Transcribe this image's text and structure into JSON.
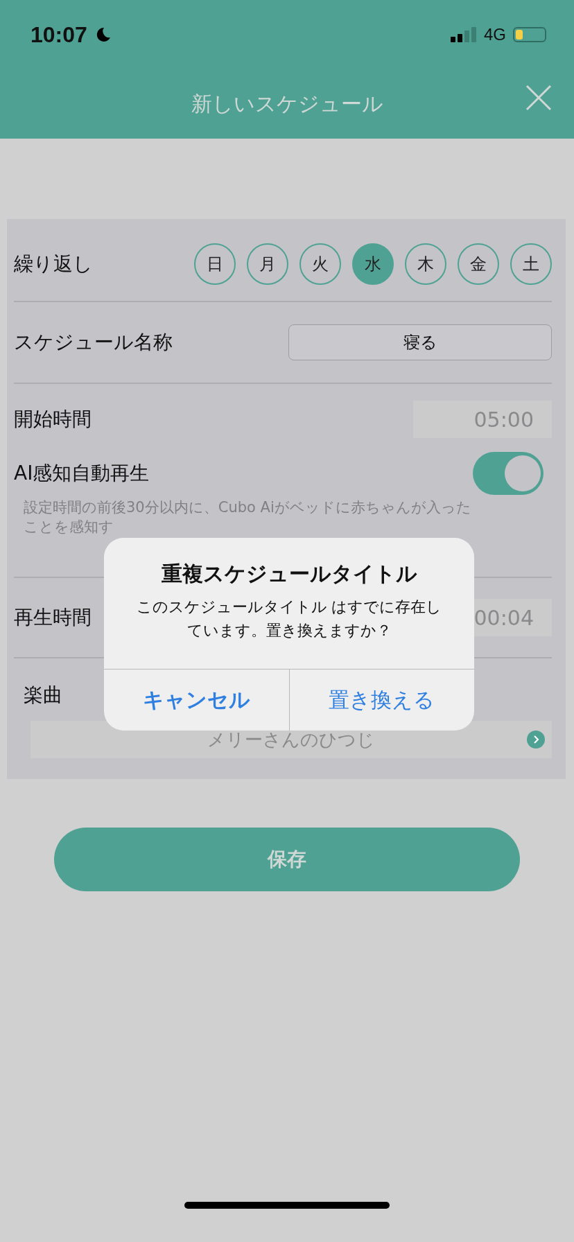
{
  "status_bar": {
    "time": "10:07",
    "network": "4G"
  },
  "header": {
    "title": "新しいスケジュール"
  },
  "form": {
    "repeat": {
      "label": "繰り返し",
      "days": [
        {
          "label": "日",
          "selected": false
        },
        {
          "label": "月",
          "selected": false
        },
        {
          "label": "火",
          "selected": false
        },
        {
          "label": "水",
          "selected": true
        },
        {
          "label": "木",
          "selected": false
        },
        {
          "label": "金",
          "selected": false
        },
        {
          "label": "土",
          "selected": false
        }
      ]
    },
    "name": {
      "label": "スケジュール名称",
      "value": "寝る"
    },
    "start_time": {
      "label": "開始時間",
      "value": "05:00"
    },
    "ai_autoplay": {
      "label": "AI感知自動再生",
      "on": true
    },
    "note": "設定時間の前後30分以内に、Cubo Aiがベッドに赤ちゃんが入ったことを感知す",
    "play_time": {
      "label": "再生時間",
      "value": "00:04"
    },
    "song": {
      "label": "楽曲",
      "value": "メリーさんのひつじ"
    }
  },
  "save_button": "保存",
  "dialog": {
    "title": "重複スケジュールタイトル",
    "message": "このスケジュールタイトル はすでに存在しています。置き換えますか？",
    "buttons": [
      {
        "label": "キャンセル",
        "kind": "cancel"
      },
      {
        "label": "置き換える",
        "kind": "default"
      }
    ]
  }
}
